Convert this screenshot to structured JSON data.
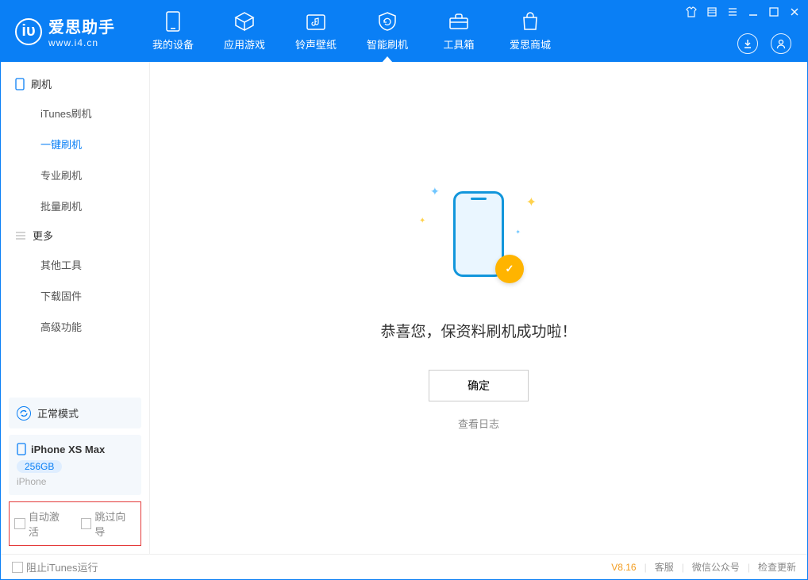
{
  "app": {
    "title": "爱思助手",
    "subtitle": "www.i4.cn"
  },
  "nav": {
    "my_device": "我的设备",
    "apps_games": "应用游戏",
    "ringwall": "铃声壁纸",
    "smart_flash": "智能刷机",
    "tools": "工具箱",
    "store": "爱思商城"
  },
  "sidebar": {
    "flash_section": "刷机",
    "items": {
      "itunes_flash": "iTunes刷机",
      "oneclick_flash": "一键刷机",
      "pro_flash": "专业刷机",
      "batch_flash": "批量刷机"
    },
    "more_section": "更多",
    "more_items": {
      "other_tools": "其他工具",
      "download_fw": "下载固件",
      "advanced": "高级功能"
    },
    "mode_label": "正常模式",
    "device": {
      "name": "iPhone XS Max",
      "storage": "256GB",
      "type": "iPhone"
    },
    "opts": {
      "auto_activate": "自动激活",
      "skip_guide": "跳过向导"
    }
  },
  "main": {
    "result_title": "恭喜您，保资料刷机成功啦！",
    "ok_button": "确定",
    "view_log": "查看日志"
  },
  "footer": {
    "block_itunes": "阻止iTunes运行",
    "version": "V8.16",
    "support": "客服",
    "wechat": "微信公众号",
    "check_update": "检查更新"
  }
}
